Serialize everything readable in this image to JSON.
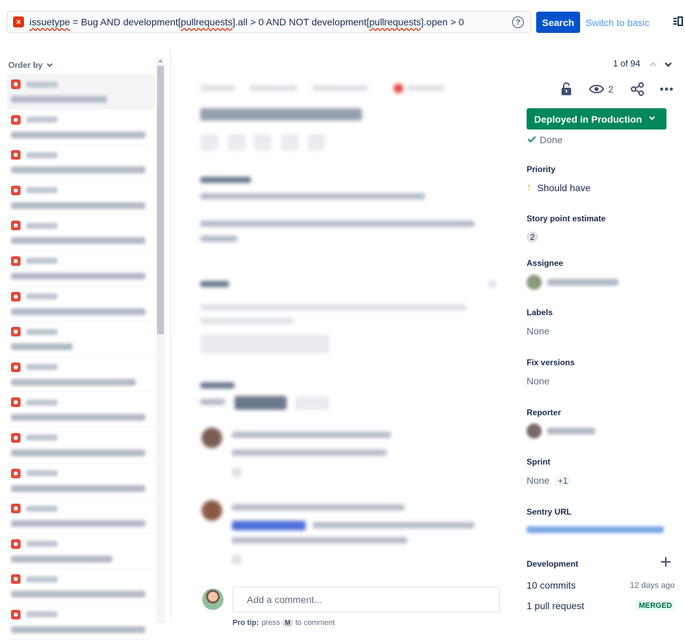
{
  "search": {
    "query": "issuetype = Bug AND development[pullrequests].all > 0 AND NOT development[pullrequests].open > 0",
    "query_parts": [
      "issuetype",
      " = Bug AND development[",
      "pullrequests",
      "].all > 0 AND NOT development[",
      "pullrequests",
      "].open > 0"
    ],
    "help_glyph": "?",
    "search_label": "Search",
    "switch_label": "Switch to basic"
  },
  "list": {
    "order_label": "Order by",
    "item_count": 16
  },
  "pager": {
    "position": "1 of 94"
  },
  "actions": {
    "watchers": "2"
  },
  "details": {
    "status_label": "Deployed in Production",
    "resolution": "Done",
    "priority_label": "Priority",
    "priority_value": "Should have",
    "story_points_label": "Story point estimate",
    "story_points_value": "2",
    "assignee_label": "Assignee",
    "labels_label": "Labels",
    "labels_value": "None",
    "fix_versions_label": "Fix versions",
    "fix_versions_value": "None",
    "reporter_label": "Reporter",
    "sprint_label": "Sprint",
    "sprint_value": "None",
    "sprint_extra": "+1",
    "sentry_label": "Sentry URL",
    "development_label": "Development",
    "commits": "10 commits",
    "commits_time": "12 days ago",
    "pull_requests": "1 pull request",
    "pr_status": "MERGED"
  },
  "comment": {
    "placeholder": "Add a comment...",
    "protip_prefix": "Pro tip:",
    "protip_press": "press",
    "protip_key": "M",
    "protip_suffix": "to comment"
  },
  "colors": {
    "primary": "#0052cc",
    "status_green": "#00875a",
    "bug_red": "#e5493a",
    "priority_orange": "#ff8b00"
  }
}
